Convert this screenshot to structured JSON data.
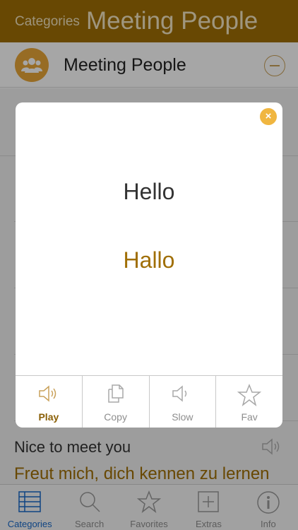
{
  "nav": {
    "back_label": "Categories",
    "title": "Meeting People"
  },
  "category": {
    "label": "Meeting People",
    "icon": "people-group-icon",
    "collapse_icon": "minus-circle-icon"
  },
  "modal": {
    "english": "Hello",
    "translation": "Hallo",
    "close_icon": "close-icon",
    "actions": [
      {
        "label": "Play",
        "icon": "speaker-icon"
      },
      {
        "label": "Copy",
        "icon": "copy-icon"
      },
      {
        "label": "Slow",
        "icon": "speaker-icon"
      },
      {
        "label": "Fav",
        "icon": "star-icon"
      }
    ]
  },
  "phrase": {
    "english": "Nice to meet you",
    "translation": "Freut mich, dich kennen zu lernen",
    "icon": "speaker-icon"
  },
  "tabs": [
    {
      "label": "Categories",
      "icon": "list-icon",
      "active": true
    },
    {
      "label": "Search",
      "icon": "search-icon",
      "active": false
    },
    {
      "label": "Favorites",
      "icon": "star-icon",
      "active": false
    },
    {
      "label": "Extras",
      "icon": "plus-square-icon",
      "active": false
    },
    {
      "label": "Info",
      "icon": "info-icon",
      "active": false
    }
  ],
  "colors": {
    "brand": "#a06f06",
    "accent": "#e9a638",
    "tab_active": "#1769c9"
  }
}
